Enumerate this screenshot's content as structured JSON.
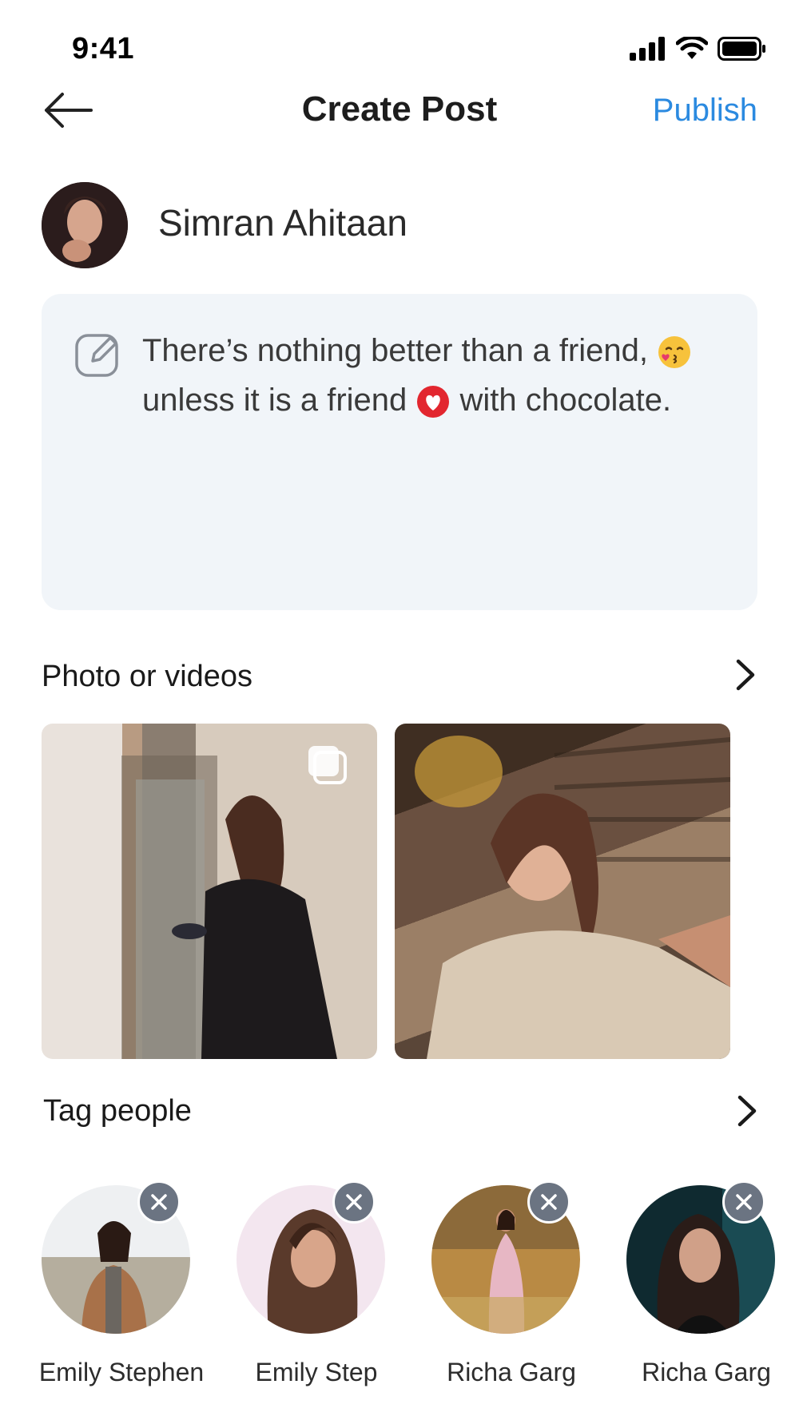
{
  "status_bar": {
    "time": "9:41"
  },
  "header": {
    "title": "Create Post",
    "publish_label": "Publish"
  },
  "author": {
    "name": "Simran Ahitaan"
  },
  "composer": {
    "line1": "There’s nothing better than a friend,",
    "line2_a": "unless it is a friend",
    "line2_b": "with chocolate.",
    "emojis": [
      "kissing-face-with-heart-emoji",
      "heart-emoji"
    ]
  },
  "media_section": {
    "title": "Photo or videos",
    "items": [
      {
        "kind": "photo-multiple",
        "icon": "multiple-photos-icon"
      },
      {
        "kind": "photo"
      }
    ]
  },
  "tag_section": {
    "title": "Tag people",
    "people": [
      {
        "name": "Emily Stephen"
      },
      {
        "name": "Emily Step"
      },
      {
        "name": "Richa Garg"
      },
      {
        "name": "Richa Garg"
      }
    ]
  },
  "colors": {
    "accent": "#2b8ae0",
    "composer_bg": "#f1f5f9",
    "remove_badge": "#6b7482"
  }
}
